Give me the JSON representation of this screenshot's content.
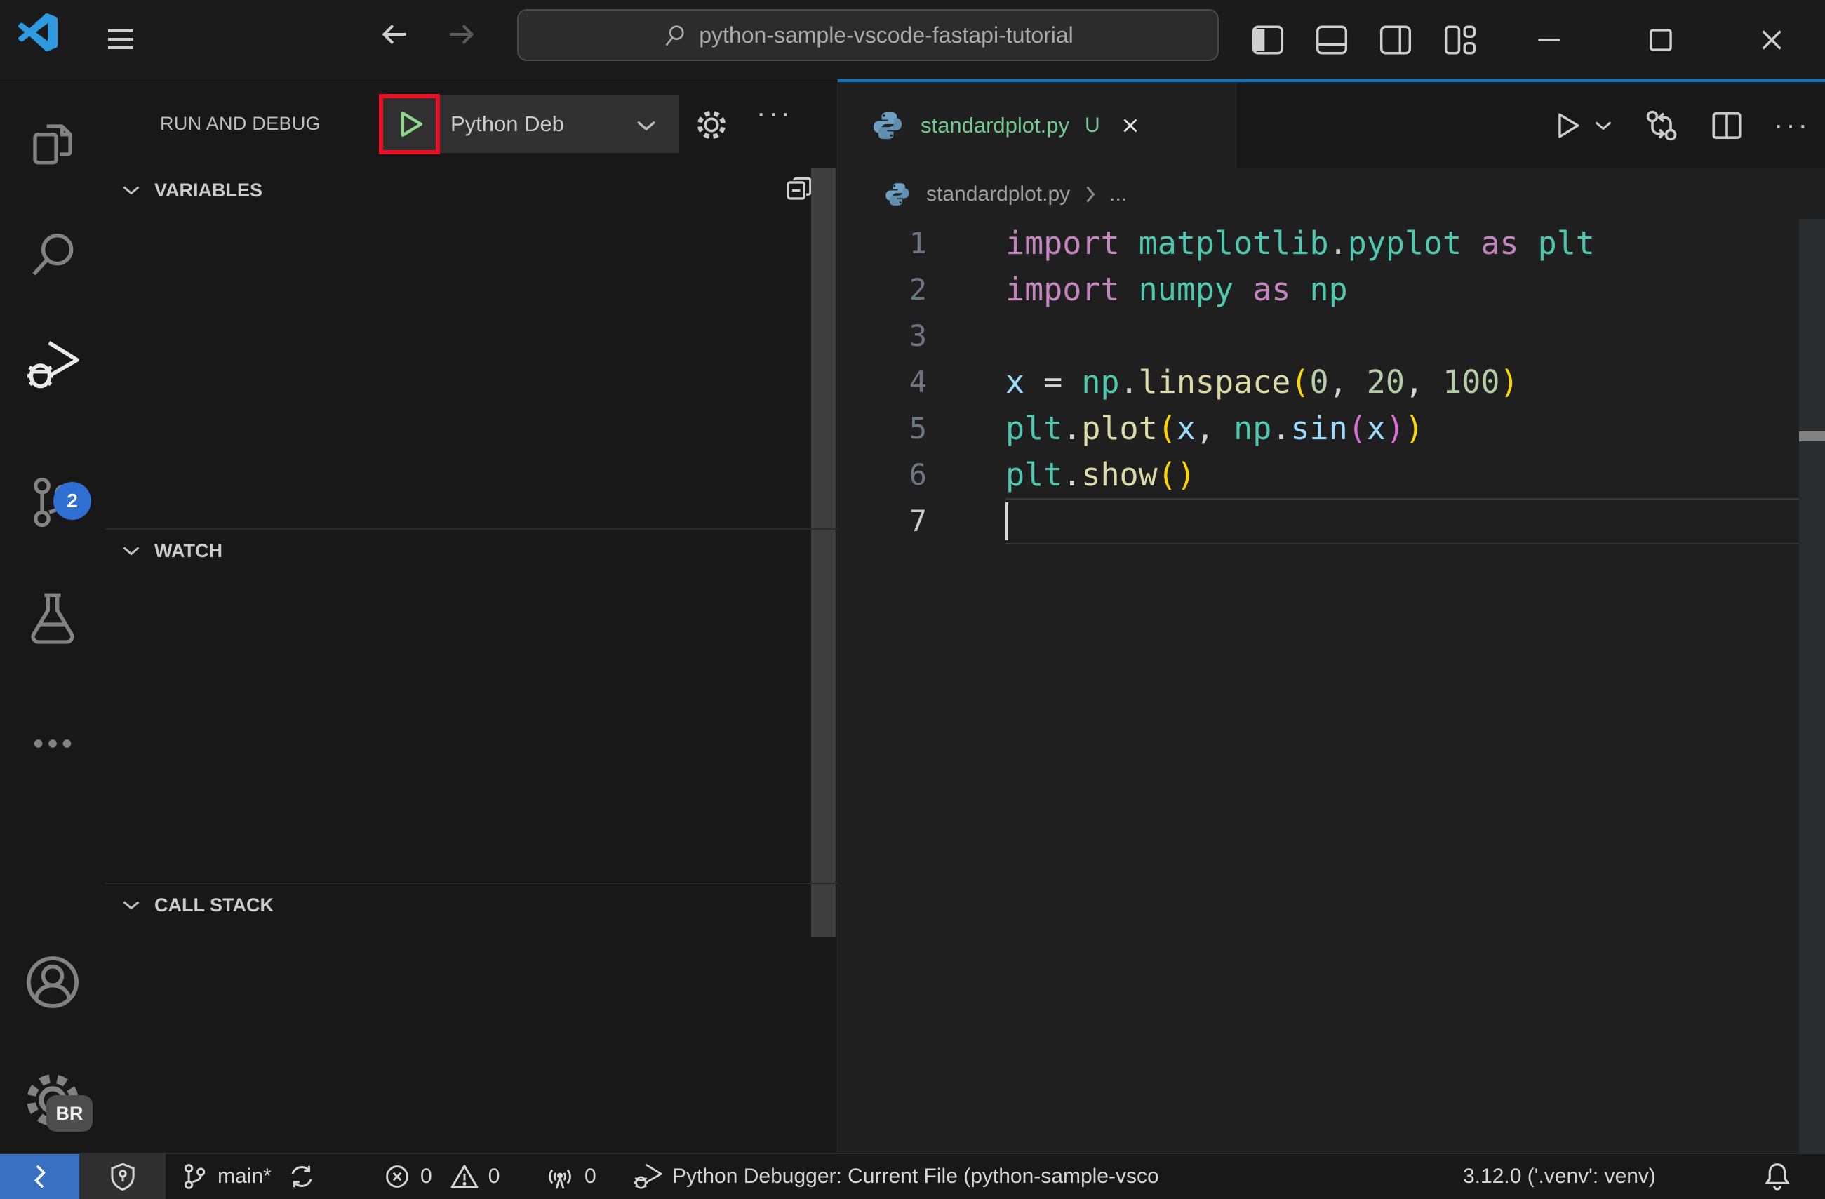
{
  "title_bar": {
    "search_value": "python-sample-vscode-fastapi-tutorial"
  },
  "activity_bar": {
    "scm_badge": "2",
    "profile_badge": "BR"
  },
  "sidebar": {
    "header_title": "RUN AND DEBUG",
    "debug_dropdown_value": "Python Deb",
    "sections": {
      "variables": "VARIABLES",
      "watch": "WATCH",
      "call_stack": "CALL STACK"
    }
  },
  "editor": {
    "tab": {
      "file_name": "standardplot.py",
      "modified_badge": "U"
    },
    "breadcrumb": {
      "file_name": "standardplot.py",
      "ellipsis": "..."
    },
    "code": {
      "active_line": 7,
      "lines": [
        [
          {
            "c": "kw",
            "t": "import"
          },
          {
            "c": "pl",
            "t": " "
          },
          {
            "c": "ns",
            "t": "matplotlib"
          },
          {
            "c": "op",
            "t": "."
          },
          {
            "c": "ns",
            "t": "pyplot"
          },
          {
            "c": "pl",
            "t": " "
          },
          {
            "c": "kw",
            "t": "as"
          },
          {
            "c": "pl",
            "t": " "
          },
          {
            "c": "ns",
            "t": "plt"
          }
        ],
        [
          {
            "c": "kw",
            "t": "import"
          },
          {
            "c": "pl",
            "t": " "
          },
          {
            "c": "ns",
            "t": "numpy"
          },
          {
            "c": "pl",
            "t": " "
          },
          {
            "c": "kw",
            "t": "as"
          },
          {
            "c": "pl",
            "t": " "
          },
          {
            "c": "ns",
            "t": "np"
          }
        ],
        [],
        [
          {
            "c": "var",
            "t": "x"
          },
          {
            "c": "pl",
            "t": " "
          },
          {
            "c": "op",
            "t": "="
          },
          {
            "c": "pl",
            "t": " "
          },
          {
            "c": "ns",
            "t": "np"
          },
          {
            "c": "op",
            "t": "."
          },
          {
            "c": "fn",
            "t": "linspace"
          },
          {
            "c": "b1",
            "t": "("
          },
          {
            "c": "num",
            "t": "0"
          },
          {
            "c": "op",
            "t": ","
          },
          {
            "c": "pl",
            "t": " "
          },
          {
            "c": "num",
            "t": "20"
          },
          {
            "c": "op",
            "t": ","
          },
          {
            "c": "pl",
            "t": " "
          },
          {
            "c": "num",
            "t": "100"
          },
          {
            "c": "b1",
            "t": ")"
          }
        ],
        [
          {
            "c": "ns",
            "t": "plt"
          },
          {
            "c": "op",
            "t": "."
          },
          {
            "c": "fn",
            "t": "plot"
          },
          {
            "c": "b1",
            "t": "("
          },
          {
            "c": "var",
            "t": "x"
          },
          {
            "c": "op",
            "t": ","
          },
          {
            "c": "pl",
            "t": " "
          },
          {
            "c": "ns",
            "t": "np"
          },
          {
            "c": "op",
            "t": "."
          },
          {
            "c": "var",
            "t": "sin"
          },
          {
            "c": "b2",
            "t": "("
          },
          {
            "c": "var",
            "t": "x"
          },
          {
            "c": "b2",
            "t": ")"
          },
          {
            "c": "b1",
            "t": ")"
          }
        ],
        [
          {
            "c": "ns",
            "t": "plt"
          },
          {
            "c": "op",
            "t": "."
          },
          {
            "c": "fn",
            "t": "show"
          },
          {
            "c": "b1",
            "t": "("
          },
          {
            "c": "b1",
            "t": ")"
          }
        ],
        []
      ]
    }
  },
  "status_bar": {
    "branch": "main*",
    "errors": "0",
    "warnings": "0",
    "ports": "0",
    "debugger_status": "Python Debugger: Current File (python-sample-vsco",
    "python_version": "3.12.0 ('.venv': venv)"
  },
  "icons": {
    "activity": [
      "explorer-icon",
      "search-icon",
      "run-debug-icon",
      "source-control-icon",
      "testing-flask-icon",
      "more-views-icon",
      "account-icon",
      "settings-gear-icon"
    ],
    "status": [
      "remote-icon",
      "shield-icon",
      "git-branch-icon",
      "sync-icon",
      "error-icon",
      "warning-icon",
      "radio-tower-icon",
      "debug-status-icon",
      "bell-icon"
    ]
  },
  "colors": {
    "accent_blue": "#0078d4",
    "untracked_green": "#73c991",
    "annotation_red": "#e81123",
    "remote_blue": "#3a70c2",
    "badge_blue": "#2f6fd4",
    "keyword": "#c586c0",
    "namespace": "#4ec9b0",
    "function": "#dcdcaa",
    "variable": "#9cdcfe",
    "number": "#b5cea8",
    "bracket_level1": "#ffd700",
    "bracket_level2": "#da70d6"
  }
}
